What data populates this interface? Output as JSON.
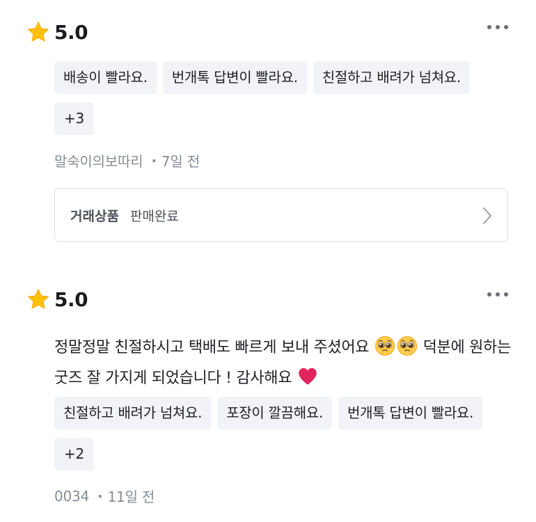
{
  "reviews": [
    {
      "rating": "5.0",
      "tags": [
        "배송이 빨라요.",
        "번개톡 답변이 빨라요.",
        "친절하고 배려가 넘쳐요.",
        "+3"
      ],
      "author": "말숙이의보따리",
      "time": "7일 전",
      "product": {
        "label": "거래상품",
        "value": "판매완료"
      }
    },
    {
      "rating": "5.0",
      "text_part1": "정말정말 친절하시고 택배도 빠르게 보내 주셨어요 ",
      "text_part2": " 덕분에 원하는 굿즈 잘 가지게 되었습니다 ! 감사해요 ",
      "tags": [
        "친절하고 배려가 넘쳐요.",
        "포장이 깔끔해요.",
        "번개톡 답변이 빨라요.",
        "+2"
      ],
      "author": "0034",
      "time": "11일 전"
    }
  ],
  "icons": {
    "star": "star-icon",
    "more": "more-options-icon",
    "chevron": "chevron-right-icon",
    "emoji_pleading": "pleading-face-emoji",
    "emoji_heart": "red-heart-emoji"
  },
  "colors": {
    "star": "#FFC107",
    "tag_bg": "#F2F3F6",
    "meta_text": "#868B94",
    "heart": "#E0245E"
  }
}
